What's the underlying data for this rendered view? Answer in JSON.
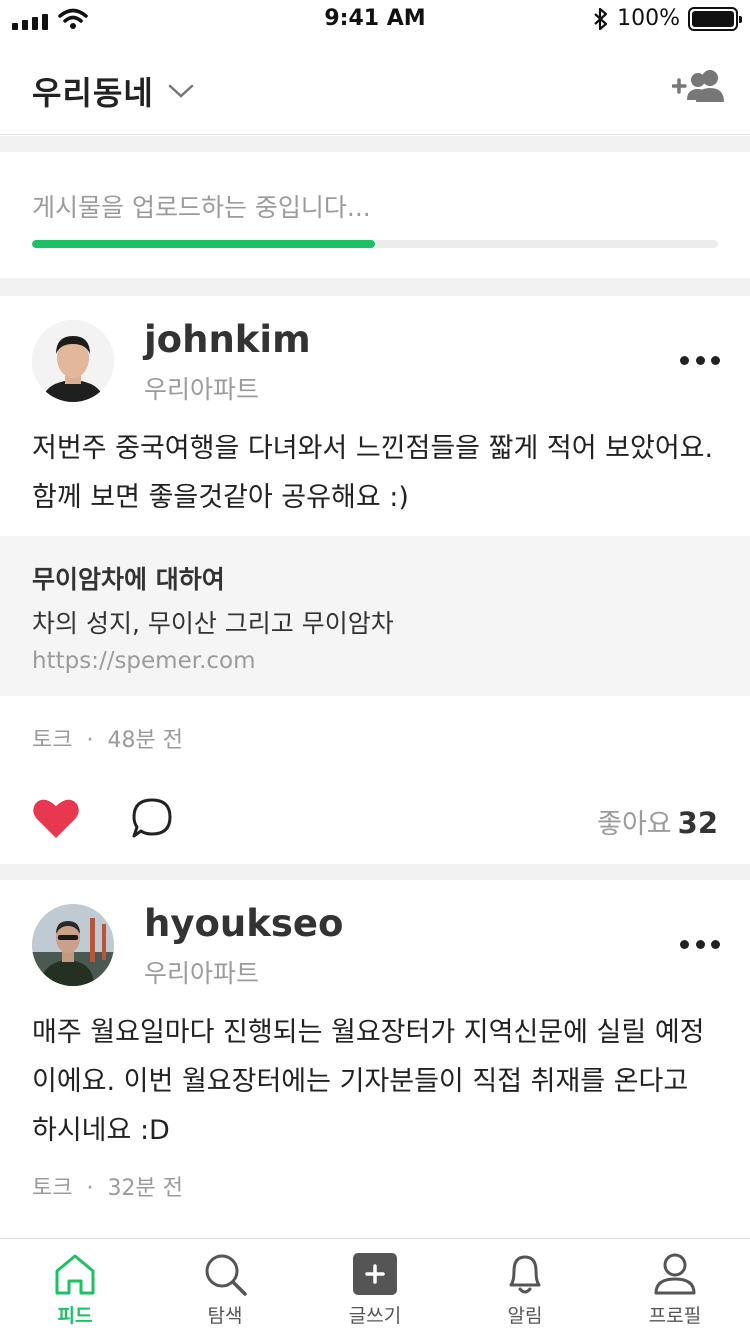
{
  "status_bar": {
    "time": "9:41 AM",
    "battery": "100%"
  },
  "header": {
    "title": "우리동네"
  },
  "upload": {
    "text": "게시물을 업로드하는 중입니다...",
    "progress": 0.5
  },
  "posts": [
    {
      "username": "johnkim",
      "location": "우리아파트",
      "body": "저번주 중국여행을 다녀와서 느낀점들을 짧게 적어 보았어요. 함께 보면 좋을것같아 공유해요 :)",
      "link": {
        "title": "무이암차에 대하여",
        "description": "차의 성지, 무이산 그리고 무이암차",
        "url": "https://spemer.com"
      },
      "category": "토크",
      "time": "48분 전",
      "likes_label": "좋아요",
      "likes_count": "32"
    },
    {
      "username": "hyoukseo",
      "location": "우리아파트",
      "body": "매주 월요일마다 진행되는 월요장터가 지역신문에 실릴 예정이에요. 이번 월요장터에는 기자분들이 직접 취재를 온다고 하시네요 :D",
      "category": "토크",
      "time": "32분 전"
    }
  ],
  "tabs": [
    {
      "label": "피드",
      "icon": "home-icon"
    },
    {
      "label": "탐색",
      "icon": "search-icon"
    },
    {
      "label": "글쓰기",
      "icon": "write-icon"
    },
    {
      "label": "알림",
      "icon": "bell-icon"
    },
    {
      "label": "프로필",
      "icon": "profile-icon"
    }
  ],
  "colors": {
    "accent": "#1ec065",
    "like": "#e8384f"
  }
}
